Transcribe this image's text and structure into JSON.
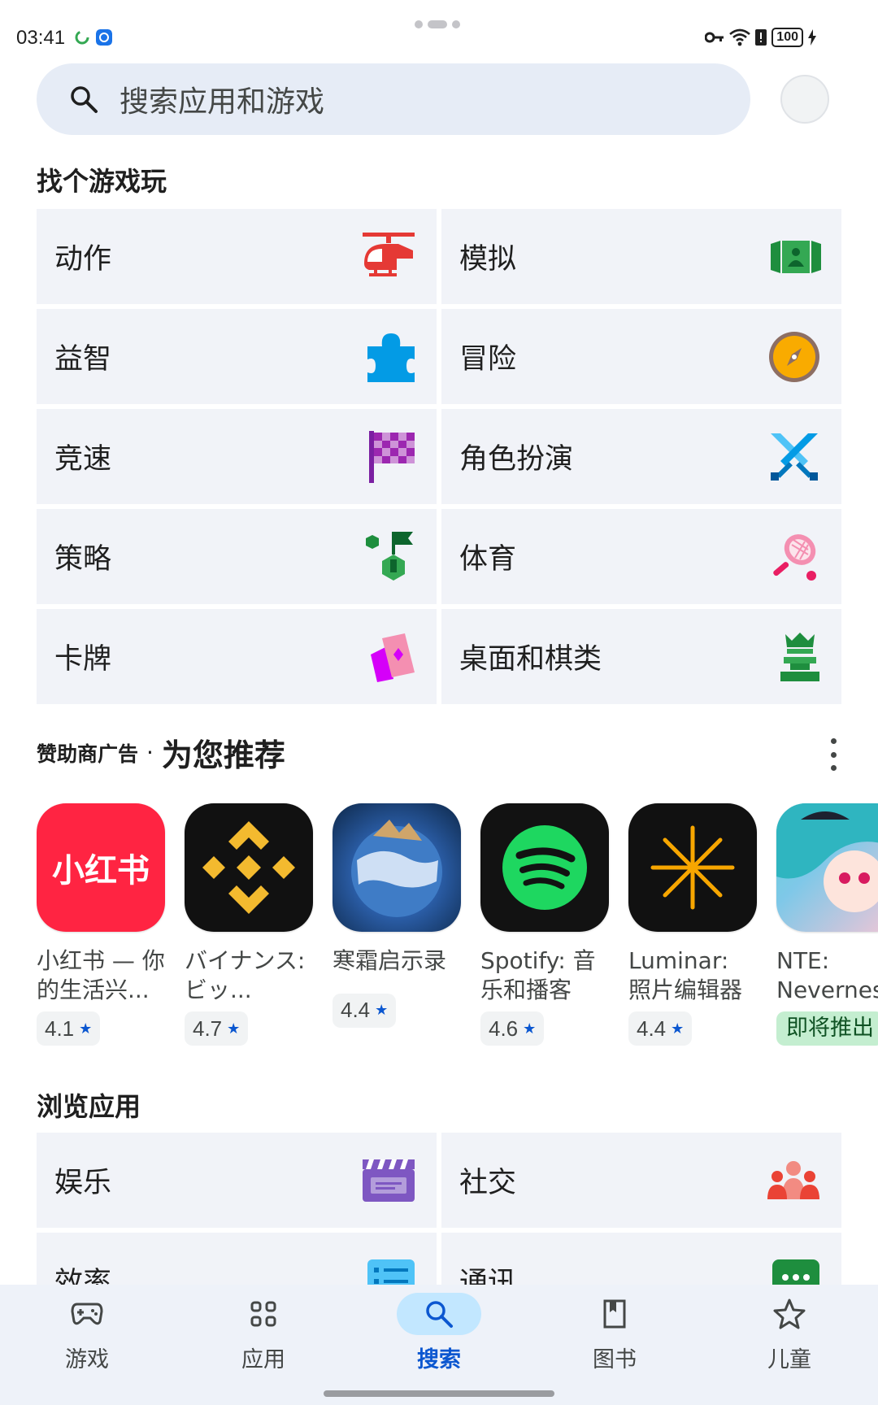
{
  "status_bar": {
    "time": "03:41",
    "battery": "100"
  },
  "search": {
    "placeholder": "搜索应用和游戏"
  },
  "games_section": {
    "title": "找个游戏玩",
    "categories": [
      {
        "label": "动作",
        "icon": "helicopter-icon"
      },
      {
        "label": "模拟",
        "icon": "simulation-icon"
      },
      {
        "label": "益智",
        "icon": "puzzle-icon"
      },
      {
        "label": "冒险",
        "icon": "compass-icon"
      },
      {
        "label": "竞速",
        "icon": "checkered-flag-icon"
      },
      {
        "label": "角色扮演",
        "icon": "crossed-swords-icon"
      },
      {
        "label": "策略",
        "icon": "strategy-icon"
      },
      {
        "label": "体育",
        "icon": "tennis-racket-icon"
      },
      {
        "label": "卡牌",
        "icon": "cards-icon"
      },
      {
        "label": "桌面和棋类",
        "icon": "chess-piece-icon"
      }
    ]
  },
  "recommended": {
    "ad_label": "赞助商广告",
    "separator": "·",
    "title": "为您推荐",
    "apps": [
      {
        "name": "小红书 — 你的生活兴...",
        "rating": "4.1",
        "icon_text": "小红书"
      },
      {
        "name": "バイナンス: ビッ...",
        "rating": "4.7"
      },
      {
        "name": "寒霜启示录",
        "rating": "4.4"
      },
      {
        "name": "Spotify: 音乐和播客",
        "rating": "4.6"
      },
      {
        "name": "Luminar: 照片编辑器",
        "rating": "4.4"
      },
      {
        "name": "NTE: Neverness",
        "badge": "即将推出"
      }
    ]
  },
  "browse_section": {
    "title": "浏览应用",
    "categories": [
      {
        "label": "娱乐",
        "icon": "clapperboard-icon"
      },
      {
        "label": "社交",
        "icon": "people-icon"
      },
      {
        "label": "效率",
        "icon": "list-icon"
      },
      {
        "label": "通讯",
        "icon": "chat-icon"
      }
    ]
  },
  "bottom_nav": {
    "items": [
      {
        "label": "游戏",
        "icon": "gamepad-icon"
      },
      {
        "label": "应用",
        "icon": "apps-grid-icon"
      },
      {
        "label": "搜索",
        "icon": "search-icon",
        "active": true
      },
      {
        "label": "图书",
        "icon": "book-icon"
      },
      {
        "label": "儿童",
        "icon": "star-icon"
      }
    ]
  },
  "colors": {
    "accent": "#0b57d0",
    "tile_bg": "#f1f3f8",
    "search_bg": "#e6ecf6",
    "nav_active": "#c2e7ff"
  }
}
